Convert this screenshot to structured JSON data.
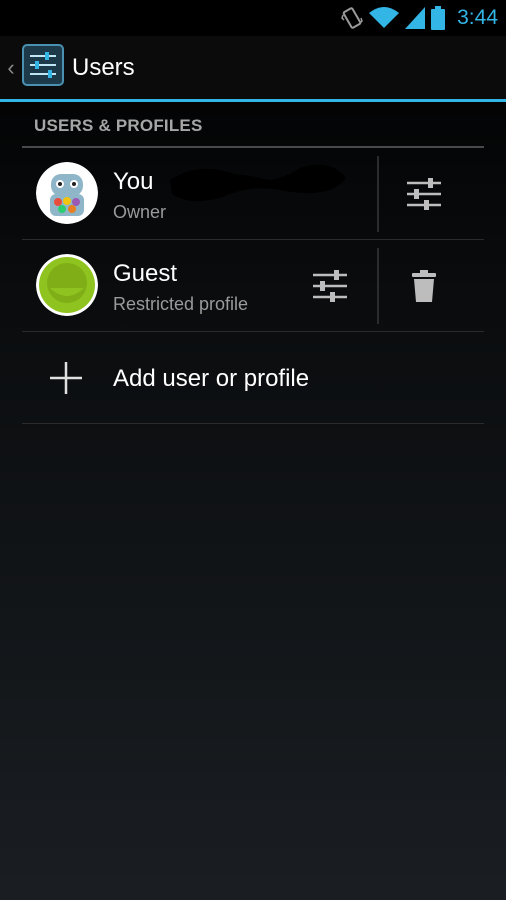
{
  "status_bar": {
    "time": "3:44",
    "icons": [
      "vibrate-icon",
      "wifi-icon",
      "signal-icon",
      "battery-icon"
    ],
    "accent_color": "#33b5e5"
  },
  "action_bar": {
    "title": "Users",
    "icon": "settings-sliders-icon"
  },
  "section": {
    "header": "USERS & PROFILES"
  },
  "users": [
    {
      "name": "You",
      "subtitle": "Owner",
      "icon": "android-jellybean-avatar",
      "actions": [
        "settings-icon"
      ]
    },
    {
      "name": "Guest",
      "subtitle": "Restricted profile",
      "icon": "guest-avatar-icon",
      "actions": [
        "settings-icon",
        "trash-icon"
      ]
    }
  ],
  "add": {
    "label": "Add user or profile",
    "icon": "plus-icon"
  }
}
